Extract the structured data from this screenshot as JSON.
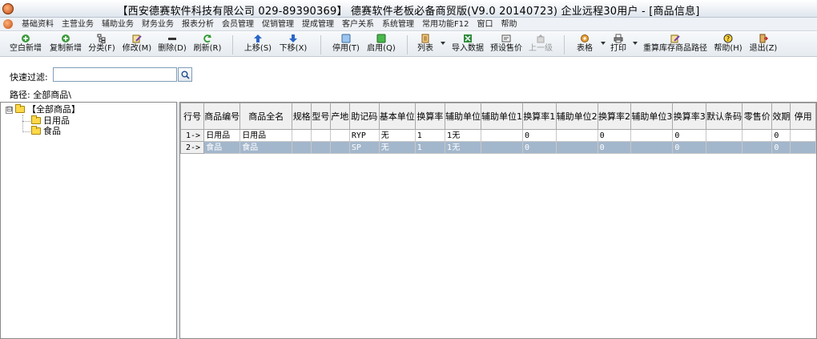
{
  "window": {
    "title": "【西安德赛软件科技有限公司 029-89390369】 德赛软件老板必备商贸版(V9.0 20140723) 企业远程30用户 - [商品信息]"
  },
  "menu": [
    "基础资料",
    "主营业务",
    "辅助业务",
    "财务业务",
    "报表分析",
    "会员管理",
    "促销管理",
    "提成管理",
    "客户关系",
    "系统管理",
    "常用功能F12",
    "窗口",
    "帮助"
  ],
  "toolbar": {
    "new_blank": "空白新增",
    "copy_new": "复制新增",
    "category": "分类(F)",
    "modify": "修改(M)",
    "delete": "删除(D)",
    "refresh": "刷新(R)",
    "move_up": "上移(S)",
    "move_down": "下移(X)",
    "disable": "停用(T)",
    "enable": "启用(Q)",
    "list": "列表",
    "import": "导入数据",
    "preset_price": "预设售价",
    "parent_level": "上一级",
    "table": "表格",
    "print": "打印",
    "recalc_path": "重算库存商品路径",
    "help": "帮助(H)",
    "exit": "退出(Z)"
  },
  "filter": {
    "label": "快速过滤:",
    "value": ""
  },
  "path": {
    "label": "路径:",
    "value": "全部商品\\"
  },
  "tree": {
    "expander": "⊟",
    "root": "【全部商品】",
    "children": [
      "日用品",
      "食品"
    ]
  },
  "grid": {
    "columns": [
      "行号",
      "商品编号",
      "商品全名",
      "规格",
      "型号",
      "产地",
      "助记码",
      "基本单位",
      "换算率",
      "辅助单位",
      "辅助单位1",
      "换算率1",
      "辅助单位2",
      "换算率2",
      "辅助单位3",
      "换算率3",
      "默认条码",
      "零售价",
      "效期",
      "停用"
    ],
    "rows": [
      [
        "1->",
        "日用品",
        "日用品",
        "",
        "",
        "",
        "RYP",
        "无",
        "1",
        "1无",
        "",
        "0",
        "",
        "0",
        "",
        "0",
        "",
        "",
        "0",
        ""
      ],
      [
        "2->",
        "食品",
        "食品",
        "",
        "",
        "",
        "SP",
        "无",
        "1",
        "1无",
        "",
        "0",
        "",
        "0",
        "",
        "0",
        "",
        "",
        "0",
        ""
      ]
    ]
  },
  "colors": {
    "selected_row": "#a3b7cc",
    "header_bg": "#f0f0f0"
  }
}
